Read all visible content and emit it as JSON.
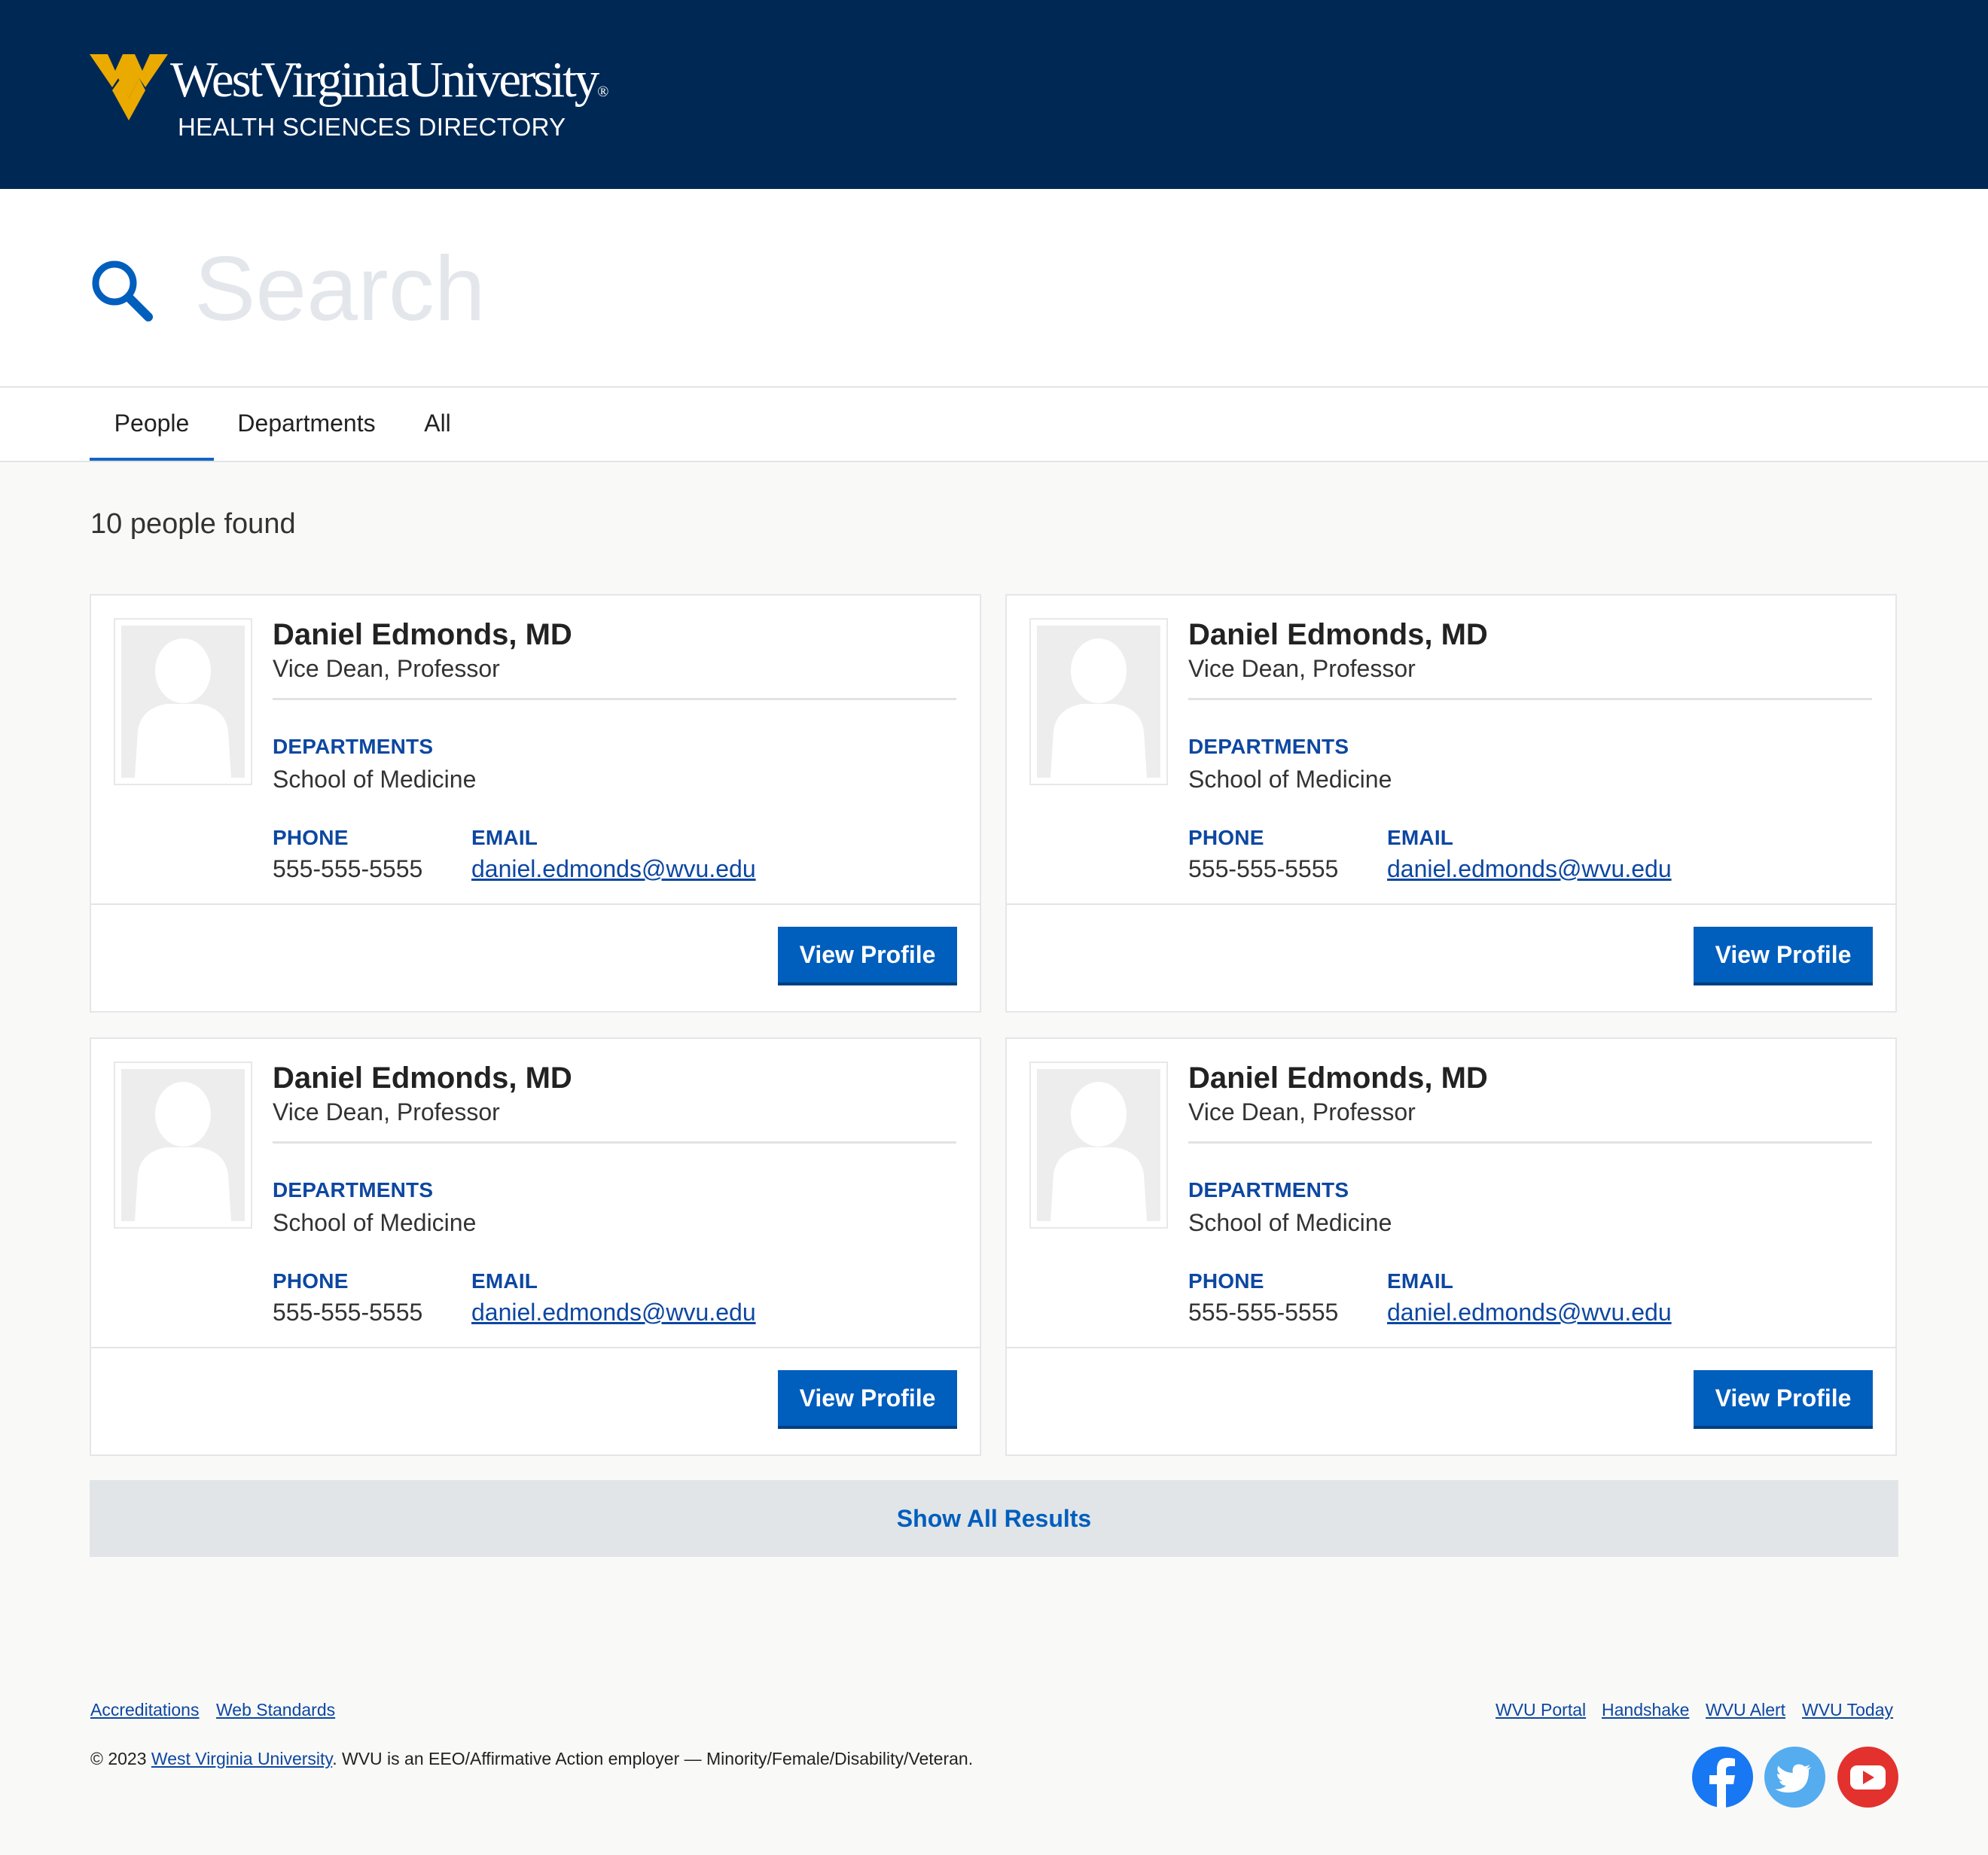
{
  "header": {
    "university_name": "WestVirginiaUniversity",
    "registered_mark": "®",
    "directory_title": "HEALTH SCIENCES DIRECTORY",
    "brand_gold": "#EAAA00",
    "brand_navy": "#002855"
  },
  "search": {
    "placeholder": "Search",
    "value": ""
  },
  "tabs": [
    {
      "label": "People",
      "active": true
    },
    {
      "label": "Departments",
      "active": false
    },
    {
      "label": "All",
      "active": false
    }
  ],
  "results_count": "10 people found",
  "labels": {
    "departments": "DEPARTMENTS",
    "phone": "PHONE",
    "email": "EMAIL",
    "view_profile": "View Profile"
  },
  "people": [
    {
      "name": "Daniel Edmonds, MD",
      "title": "Vice Dean, Professor",
      "department": "School of Medicine",
      "phone": "555-555-5555",
      "email": "daniel.edmonds@wvu.edu"
    },
    {
      "name": "Daniel Edmonds, MD",
      "title": "Vice Dean, Professor",
      "department": "School of Medicine",
      "phone": "555-555-5555",
      "email": "daniel.edmonds@wvu.edu"
    },
    {
      "name": "Daniel Edmonds, MD",
      "title": "Vice Dean, Professor",
      "department": "School of Medicine",
      "phone": "555-555-5555",
      "email": "daniel.edmonds@wvu.edu"
    },
    {
      "name": "Daniel Edmonds, MD",
      "title": "Vice Dean, Professor",
      "department": "School of Medicine",
      "phone": "555-555-5555",
      "email": "daniel.edmonds@wvu.edu"
    }
  ],
  "show_all_label": "Show All Results",
  "footer": {
    "left_links": [
      "Accreditations",
      "Web Standards"
    ],
    "right_links": [
      "WVU Portal",
      "Handshake",
      "WVU Alert",
      "WVU Today"
    ],
    "copyright_prefix": "© 2023 ",
    "copyright_link": "West Virginia University",
    "copyright_suffix": ". WVU is an EEO/Affirmative Action employer — Minority/Female/Disability/Veteran.",
    "social": [
      {
        "icon": "facebook-icon",
        "color": "#1877f2"
      },
      {
        "icon": "twitter-icon",
        "color": "#55acee"
      },
      {
        "icon": "youtube-icon",
        "color": "#e3312d"
      }
    ]
  }
}
